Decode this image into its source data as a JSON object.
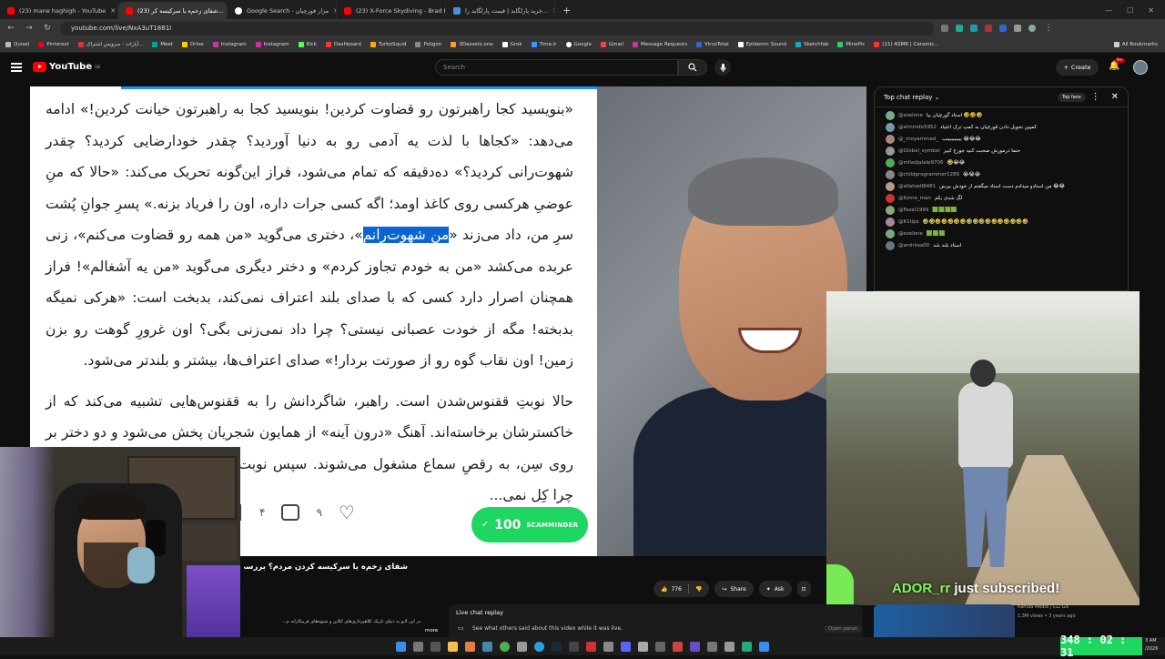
{
  "browser": {
    "tabs": [
      {
        "title": "(23) mane haghigh - YouTube",
        "color": "#ff0000"
      },
      {
        "title": "(23) شفای زخم‌ه یا سرکیسه کر...",
        "color": "#ff0000"
      },
      {
        "title": "Google Search - مزار قورچیان",
        "color": "#ffffff"
      },
      {
        "title": "(23) X-Force Skydiving - Brad H...",
        "color": "#ff0000"
      },
      {
        "title": "خرید پارلگاید | قیمت پارلگاید را...",
        "color": "#4a90e2"
      }
    ],
    "url": "youtube.com/live/NxA3uT1881I",
    "bookmarks": [
      "Quixel",
      "Pinterest",
      "آپارات - سرویس اشتراک...",
      "Meet",
      "Drive",
      "Instagram",
      "Instagram",
      "Kick",
      "Dashboard",
      "TurboSquid",
      "Poligon",
      "3Dassets.one",
      "Grok",
      "Time.ir",
      "Google",
      "Gmail",
      "Message Requests",
      "VirusTotal",
      "Epidemic Sound",
      "Sketchfab",
      "MinePic",
      "(11) ASMR | Ceramic...",
      "All Bookmarks"
    ]
  },
  "youtube": {
    "region": "GB",
    "search_placeholder": "Search",
    "create_label": "Create",
    "notif_count": "9+"
  },
  "article": {
    "paragraph1_before": "«بنویسید کجا راهبرتون رو قضاوت کردین! بنویسید کجا به راهبرتون خیانت کردین!» ادامه می‌دهد: «کجاها با لذت یه آدمی رو به دنیا آوردید؟ چقدر خودارضایی کردید؟ چقدر شهوت‌رانی کردید؟» ده‌دقیقه که تمام می‌شود، فراز این‌گونه تحریک می‌کند: «حالا که منِ عوضیِ هرکسی روی کاغذ اومد؛ اگه کسی جرات داره، اون را فریاد بزنه.» پسرِ جوانِ پُشت سرِ من، داد می‌زند «",
    "highlight": "من شهوت‌رانم",
    "paragraph1_after": "»، دختری می‌گوید «من همه رو قضاوت می‌کنم»، زنی عربده می‌کشد «من به خودم تجاوز کردم» و دختر دیگری می‌گوید «من یه آشغالم»! فراز همچنان اصرار دارد کسی که با صدای بلند اعتراف نمی‌کند، بدبخت است: «هرکی نمیگه بدبخته! مگه از خودت عصبانی نیستی؟ چرا داد نمی‌زنی بگی؟ اون غرورِ گوهت رو بزن زمین! اون نقاب گوه رو از صورتت بردار!» صدای اعتراف‌ها، بیشتر و بلندتر می‌شود.",
    "paragraph2": "حالا نوبتِ ققنوس‌شدن است. راهبر، شاگردانش را به ققنوس‌هایی تشبیه می‌کند که از خاکسترشان برخاسته‌اند. آهنگ «درون آینه» از همایون شجریان پخش می‌شود و دو دختر بر روی سِن، به رقصِ سماع مشغول می‌شوند. سپس نوبت... و آهنگ، همه دست می‌زنند... چرا کِل نمی...",
    "like_count": "۹",
    "comment_count": "۴"
  },
  "scamminder": {
    "label": "SCAMMINDER",
    "score": "100"
  },
  "chat": {
    "header": "Top chat replay",
    "top_fans": "Top fans",
    "messages": [
      {
        "author": "@ezelone",
        "text": "استاد گورچیان بیا 🤣🤣🤣"
      },
      {
        "author": "@elmmdo5952",
        "text": "کمپین تحویل دادن قورچیان به کمپ ترک اعتیاد"
      },
      {
        "author": "@_moyammad_",
        "text": "ببببببببببب 😂😂😂"
      },
      {
        "author": "@Global_symbol",
        "text": "حتما درمورش صحبت کنید جورج کبیر"
      },
      {
        "author": "@mlladjalale9706",
        "text": "🤣😂😂"
      },
      {
        "author": "@childprogrammer1289",
        "text": "😭😭😭"
      },
      {
        "author": "@allahadl8481",
        "text": "من استادو میدادم دست استاد میگفتم از خودش بپرس 😂😂"
      },
      {
        "author": "@Itzme_man",
        "text": "لگ شدی یکم"
      },
      {
        "author": "@Fazel1999",
        "text": "🟩🟩🟩🟩"
      },
      {
        "author": "@K1tips",
        "text": "🤣🤣🤣🤣🤣🤣🤣🤣🤣🤣🤣🤣🤣🤣🤣🤣🤣"
      },
      {
        "author": "@ezelone",
        "text": "🟩🟩🟩"
      },
      {
        "author": "@arshiiaa00",
        "text": "استاد بلند شد"
      }
    ]
  },
  "overlay": {
    "subscriber_name": "ADOR_rr",
    "subscribed_text": "just subscribed!"
  },
  "video": {
    "title": "شفای زخم‌ه یا سرکیسه کردن مردم؟ بررسی کات...",
    "like_count": "776",
    "share_label": "Share",
    "ask_label": "Ask",
    "description_snippet": "در این لایو به دنیای تاریک کلاهبرداری‌های آنلاین و شیوه‌های فریبکارانه م...",
    "more_label": "more"
  },
  "live_chat_replay": {
    "title": "Live chat replay",
    "subtitle": "See what others said about this video while it was live.",
    "open_panel": "Open panel"
  },
  "recommendation": {
    "channel": "Kamaa Media | کاما مدیا",
    "views": "1.3M views • 3 years ago"
  },
  "clock": "348 : 02 : 31",
  "system_time": {
    "time": "3 AM",
    "date": "/2026"
  }
}
